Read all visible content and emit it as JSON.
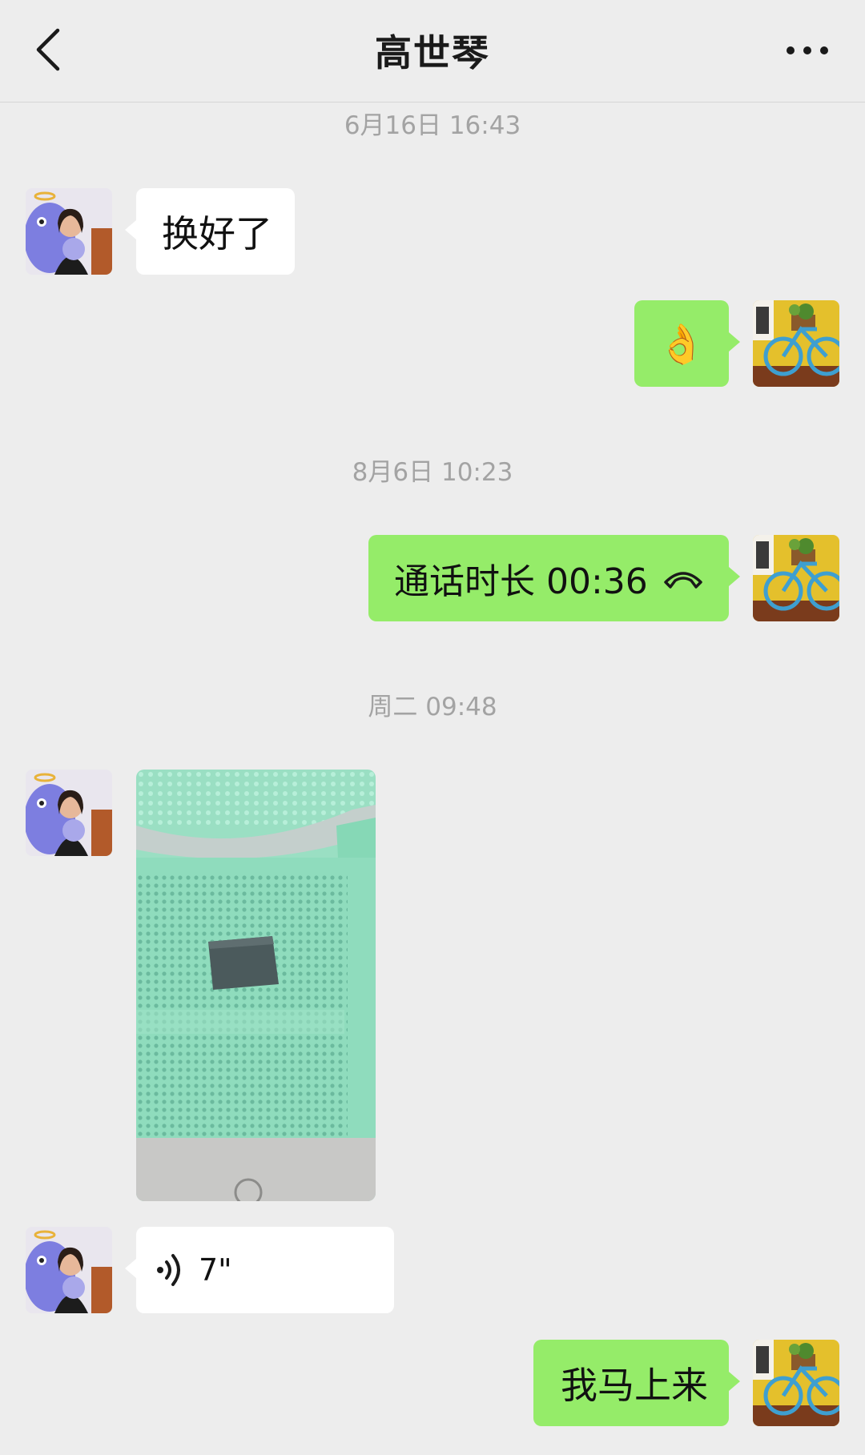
{
  "header": {
    "title": "高世琴",
    "back_icon": "chevron-left-icon",
    "more_icon": "more-horizontal-icon"
  },
  "messages": {
    "ts1": "6月16日 16:43",
    "m1_text": "换好了",
    "m2_emoji": "👌",
    "ts2": "8月6日 10:23",
    "m3_call": "通话时长 00:36",
    "m3_icon": "phone-hangup-icon",
    "ts3": "周二 09:48",
    "m4_photo": "image of perforated green chair with dark object",
    "m5_voice_duration": "7\"",
    "m5_icon": "voice-wave-icon",
    "m6_text": "我马上来"
  },
  "colors": {
    "background": "#ededed",
    "outgoing_bubble": "#95ec69",
    "incoming_bubble": "#ffffff",
    "timestamp": "#a3a3a3"
  }
}
